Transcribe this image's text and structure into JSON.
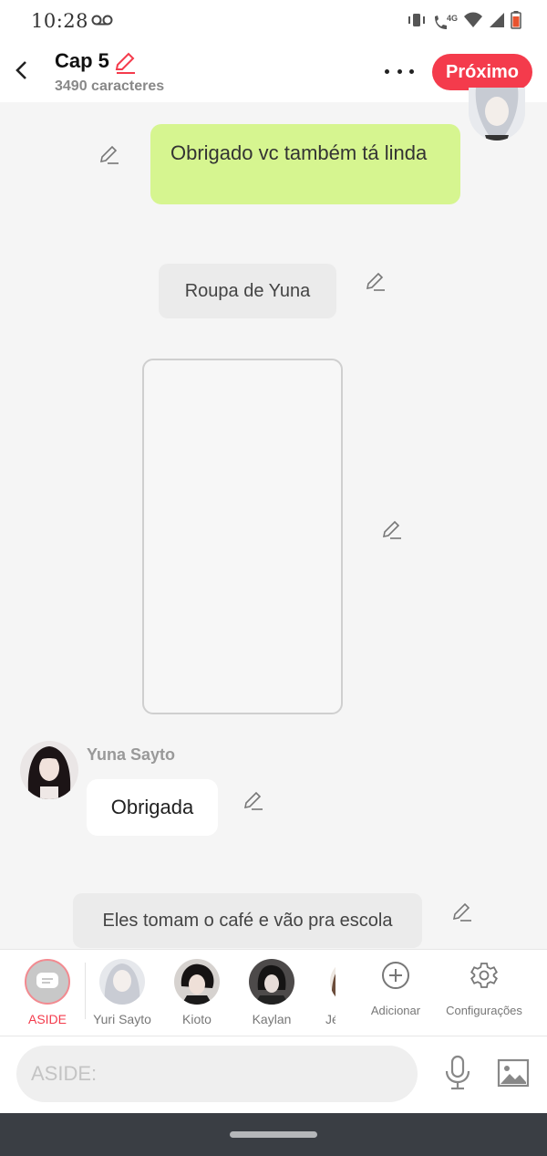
{
  "status": {
    "time": "10:28",
    "network": "4G"
  },
  "header": {
    "title": "Cap 5",
    "subtitle": "3490 caracteres",
    "next_label": "Próximo"
  },
  "messages": {
    "green_text": "Obrigado vc também tá linda",
    "narration1": "Roupa de Yuna",
    "speaker": "Yuna Sayto",
    "white_text": "Obrigada",
    "narration2": "Eles tomam o café e vão pra escola"
  },
  "characters": [
    {
      "label": "ASIDE"
    },
    {
      "label": "Yuri Sayto"
    },
    {
      "label": "Kioto"
    },
    {
      "label": "Kaylan"
    },
    {
      "label": "Jés"
    }
  ],
  "tools": {
    "add_label": "Adicionar",
    "settings_label": "Configurações"
  },
  "input": {
    "placeholder": "ASIDE:"
  },
  "colors": {
    "accent": "#f43b4c",
    "green_bubble": "#d6f590"
  }
}
